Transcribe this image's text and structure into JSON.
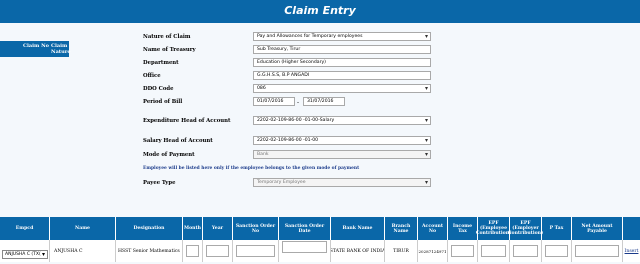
{
  "title": "Claim Entry",
  "side_table": {
    "col1": "Claim No",
    "col2": "Claim Nature"
  },
  "form": {
    "nature_of_claim": {
      "label": "Nature of Claim",
      "value": "Pay and Allowances for Temporary employees"
    },
    "name_of_treasury": {
      "label": "Name of Treasury",
      "value": "Sub Treasury, Tirur"
    },
    "department": {
      "label": "Department",
      "value": "Education (Higher Secondary)"
    },
    "office": {
      "label": "Office",
      "value": "G.G.H.S.S, B.P ANGADI"
    },
    "ddo_code": {
      "label": "DDO Code",
      "value": "086"
    },
    "period_of_bill": {
      "label": "Period of Bill",
      "from": "01/07/2016",
      "separator": "-",
      "to": "31/07/2016"
    },
    "expenditure_head": {
      "label": "Expenditure Head of Account",
      "value": "2202-02-109-86-00 -01-00-Salary"
    },
    "salary_head": {
      "label": "Salary Head of Account",
      "value": "2202-02-109-86-00 -01-00"
    },
    "mode_of_payment": {
      "label": "Mode of Payment",
      "value": "Bank"
    },
    "note": "Employee will be listed here only if the employee belongs to the given mode of payment",
    "payee_type": {
      "label": "Payee Type",
      "value": "Temporary Employee"
    }
  },
  "grid": {
    "headers": [
      "Empcd",
      "Name",
      "Designation",
      "Month",
      "Year",
      "Sanction Order No",
      "Sanction Order Date",
      "Bank Name",
      "Branch Name",
      "Account No",
      "Income Tax",
      "EPF (Employee Contribution)",
      "EPF (Employer Contribution)",
      "P Tax",
      "Net Amount Payable",
      ""
    ],
    "row": {
      "empcd": "ANJUSHA C (TX(",
      "name": "ANJUSHA C",
      "designation": "HSST Senior Mathematics",
      "bank_name": "STATE BANK OF INDIA",
      "branch_name": "TIRUR",
      "account_no": "20287124971",
      "action": "Insert"
    }
  }
}
